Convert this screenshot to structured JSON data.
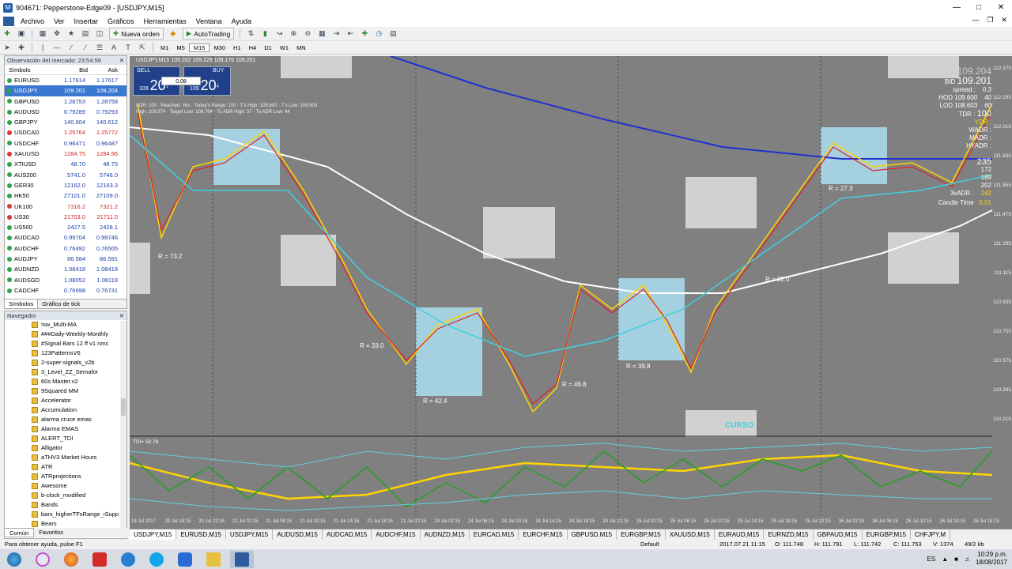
{
  "window": {
    "title": "904671: Pepperstone-Edge09 - [USDJPY,M15]"
  },
  "menu": [
    "Archivo",
    "Ver",
    "Insertar",
    "Gráficos",
    "Herramientas",
    "Ventana",
    "Ayuda"
  ],
  "toolbar": {
    "new_order": "Nueva orden",
    "autotrading": "AutoTrading"
  },
  "timeframes": [
    "M1",
    "M5",
    "M15",
    "M30",
    "H1",
    "H4",
    "D1",
    "W1",
    "MN"
  ],
  "market_watch": {
    "title": "Observación del mercado: 23:54:59",
    "headers": {
      "symbol": "Símbolo",
      "bid": "Bid",
      "ask": "Ask"
    },
    "rows": [
      {
        "symbol": "EURUSD",
        "bid": "1.17614",
        "ask": "1.17617",
        "dir": "up",
        "bid_color": "#1a3fa8"
      },
      {
        "symbol": "USDJPY",
        "bid": "109.201",
        "ask": "109.204",
        "dir": "up",
        "bid_color": "#ffffff",
        "sel": true
      },
      {
        "symbol": "GBPUSD",
        "bid": "1.28753",
        "ask": "1.28758",
        "dir": "up",
        "bid_color": "#1a3fa8"
      },
      {
        "symbol": "AUDUSD",
        "bid": "0.79289",
        "ask": "0.79293",
        "dir": "up",
        "bid_color": "#1a3fa8"
      },
      {
        "symbol": "GBPJPY",
        "bid": "140.604",
        "ask": "140.612",
        "dir": "up",
        "bid_color": "#1a3fa8"
      },
      {
        "symbol": "USDCAD",
        "bid": "1.25764",
        "ask": "1.25772",
        "dir": "down",
        "bid_color": "#d22222"
      },
      {
        "symbol": "USDCHF",
        "bid": "0.96471",
        "ask": "0.96487",
        "dir": "up",
        "bid_color": "#1a3fa8"
      },
      {
        "symbol": "XAUUSD",
        "bid": "1284.75",
        "ask": "1284.96",
        "dir": "down",
        "bid_color": "#d22222"
      },
      {
        "symbol": "XTIUSD",
        "bid": "48.70",
        "ask": "48.75",
        "dir": "up",
        "bid_color": "#1a3fa8"
      },
      {
        "symbol": "AUS200",
        "bid": "5741.0",
        "ask": "5746.0",
        "dir": "up",
        "bid_color": "#1a3fa8"
      },
      {
        "symbol": "GER30",
        "bid": "12162.0",
        "ask": "12163.3",
        "dir": "up",
        "bid_color": "#1a3fa8"
      },
      {
        "symbol": "HK50",
        "bid": "27101.0",
        "ask": "27109.0",
        "dir": "up",
        "bid_color": "#1a3fa8"
      },
      {
        "symbol": "UK100",
        "bid": "7316.2",
        "ask": "7321.2",
        "dir": "down",
        "bid_color": "#d22222"
      },
      {
        "symbol": "US30",
        "bid": "21703.0",
        "ask": "21711.0",
        "dir": "down",
        "bid_color": "#d22222"
      },
      {
        "symbol": "US500",
        "bid": "2427.5",
        "ask": "2428.1",
        "dir": "up",
        "bid_color": "#1a3fa8"
      },
      {
        "symbol": "AUDCAD",
        "bid": "0.99704",
        "ask": "0.99746",
        "dir": "up",
        "bid_color": "#1a3fa8"
      },
      {
        "symbol": "AUDCHF",
        "bid": "0.76492",
        "ask": "0.76505",
        "dir": "up",
        "bid_color": "#1a3fa8"
      },
      {
        "symbol": "AUDJPY",
        "bid": "86.584",
        "ask": "86.591",
        "dir": "up",
        "bid_color": "#1a3fa8"
      },
      {
        "symbol": "AUDNZD",
        "bid": "1.08418",
        "ask": "1.08418",
        "dir": "up",
        "bid_color": "#1a3fa8"
      },
      {
        "symbol": "AUDSGD",
        "bid": "1.08052",
        "ask": "1.08118",
        "dir": "up",
        "bid_color": "#1a3fa8"
      },
      {
        "symbol": "CADCHF",
        "bid": "0.76698",
        "ask": "0.76731",
        "dir": "up",
        "bid_color": "#1a3fa8"
      }
    ],
    "tabs": [
      "Símbolos",
      "Gráfico de tick"
    ]
  },
  "navigator": {
    "title": "Navegador",
    "items": [
      "!sw_Multi-MA",
      "###Daily-Weekly-Monthly",
      "#Signal Bars 12 ff v1 nmc",
      "123PatternsV6",
      "2-super-signals_v2b",
      "3_Level_ZZ_Semafor",
      "60s Master.v2",
      "9Squared MM",
      "Accelerator",
      "Accumulation",
      "alarma cruce emas",
      "Alarma EMAS",
      "ALERT_TDI",
      "Alligator",
      "aTHV3 Market Hours",
      "ATR",
      "ATRprojections",
      "Awesome",
      "b-clock_modified",
      "Bands",
      "bars_higherTFsRange_iSupp",
      "Bears"
    ],
    "tabs": [
      "Común",
      "Favoritos"
    ]
  },
  "chart": {
    "header": "USDJPY,M15  109.202 109.229 109.176 109.201",
    "info1": "ADR: 100 · Reached: Yes · Today's Range: 100 · T's High: 109.600 · T's Low: 108.603",
    "info2": "High: 109.574 · Target Low: 108.764 · To ADR High: 37 · To ADR Low: 44",
    "sell_label": "SELL",
    "buy_label": "BUY",
    "lot": "0.08",
    "sell_prefix": "109",
    "sell_big": "20",
    "sell_sup": "1",
    "buy_prefix": "109",
    "buy_big": "20",
    "buy_sup": "4",
    "ask_label": "ASK",
    "ask_val": "109.204",
    "bid_label": "BID",
    "bid_val": "109.201",
    "spread_label": "spread :",
    "spread_val": "0.3",
    "hod_label": "HOD 109.600",
    "hod_val": "40",
    "lod_label": "LOD 108.603",
    "lod_val": "60",
    "tdr": "TDR :",
    "tdr_val": "100",
    "ydr": "YDR :",
    "wadr": "WADR :",
    "madr": "MADR :",
    "hyadr": "HYADR :",
    "val1": "235",
    "val2": "172",
    "val3": "189",
    "val4": "202",
    "adr3": "3xADR :",
    "adr3_val": "242",
    "candle_time": "Candle Time",
    "candle_time_val": "5:01",
    "r_labels": [
      "R = 73.2",
      "R = 33.0",
      "R = 42.4",
      "R = 46.8",
      "R = 39.8",
      "R = 32.0",
      "R = 27.3"
    ],
    "curso": "CURSO",
    "tdi": "TDI+ 50.76",
    "price_axis": [
      "112.375",
      "112.195",
      "112.015",
      "111.835",
      "111.655",
      "111.475",
      "111.295",
      "111.115",
      "110.935",
      "110.755",
      "110.575",
      "110.395",
      "110.215"
    ],
    "time_axis": [
      "18 Jul 2017",
      "20 Jul 18:15",
      "20 Jul 22:15",
      "21 Jul 02:15",
      "21 Jul 06:15",
      "21 Jul 10:15",
      "21 Jul 14:15",
      "21 Jul 18:15",
      "21 Jul 22:15",
      "24 Jul 02:15",
      "24 Jul 06:15",
      "24 Jul 10:15",
      "24 Jul 14:15",
      "24 Jul 18:15",
      "24 Jul 22:15",
      "25 Jul 02:15",
      "25 Jul 06:15",
      "25 Jul 10:15",
      "25 Jul 14:15",
      "25 Jul 18:15",
      "25 Jul 22:15",
      "26 Jul 02:15",
      "26 Jul 06:15",
      "26 Jul 10:15",
      "26 Jul 14:15",
      "26 Jul 18:15"
    ]
  },
  "chart_tabs": [
    "USDJPY,M15",
    "EURUSD,M15",
    "USDJPY,M15",
    "AUDUSD,M15",
    "AUDCAD,M15",
    "AUDCHF,M15",
    "AUDNZD,M15",
    "EURCAD,M15",
    "EURCHF,M15",
    "GBPUSD,M15",
    "EURGBP,M15",
    "XAUUSD,M15",
    "EURAUD,M15",
    "EURNZD,M15",
    "GBPAUD,M15",
    "EURGBP,M15",
    "CHFJPY,M"
  ],
  "status": {
    "help": "Para obtener ayuda, pulse F1",
    "profile": "Default",
    "datetime": "2017.07.21 11:15",
    "open": "O: 111.748",
    "high": "H: 111.791",
    "low": "L: 111.742",
    "close": "C: 111.753",
    "volume": "V: 1374",
    "traffic": "49/2 kb"
  },
  "taskbar": {
    "lang": "ES",
    "time": "10:29 p.m.",
    "date": "18/08/2017"
  }
}
